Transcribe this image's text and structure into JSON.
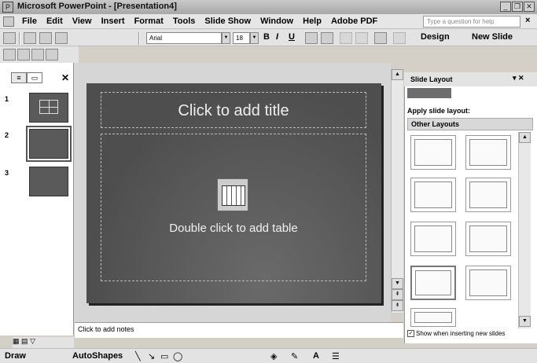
{
  "window": {
    "title": "Microsoft PowerPoint - [Presentation4]"
  },
  "menubar": {
    "items": [
      "File",
      "Edit",
      "View",
      "Insert",
      "Format",
      "Tools",
      "Slide Show",
      "Window",
      "Help",
      "Adobe PDF"
    ],
    "help_placeholder": "Type a question for help"
  },
  "formatting": {
    "font_name": "Arial",
    "font_size": "18",
    "bold": "B",
    "italic": "I",
    "underline": "U",
    "design_label": "Design",
    "new_slide_label": "New Slide"
  },
  "thumbnails": [
    {
      "number": "1"
    },
    {
      "number": "2"
    },
    {
      "number": "3"
    }
  ],
  "slide": {
    "title_placeholder": "Click to add title",
    "content_placeholder": "Double click to add table"
  },
  "notes": {
    "placeholder": "Click to add notes"
  },
  "task_pane": {
    "title": "Slide Layout",
    "apply_label": "Apply slide layout:",
    "section_label": "Other Layouts",
    "checkbox_label": "Show when inserting new slides",
    "checkbox_checked": true
  },
  "drawing": {
    "draw_label": "Draw",
    "autoshapes_label": "AutoShapes"
  }
}
